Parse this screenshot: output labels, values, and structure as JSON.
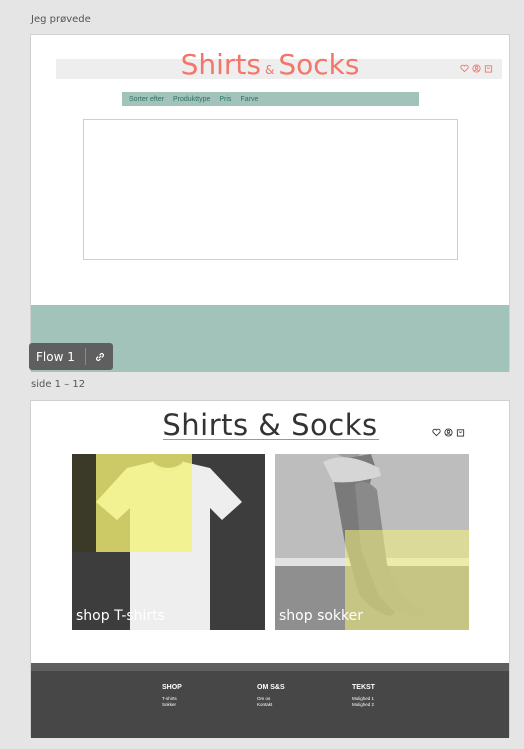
{
  "canvas": {
    "artboard1_label": "Jeg prøvede",
    "artboard2_label": "side 1 – 12"
  },
  "artboard1": {
    "title_part1": "Shirts",
    "title_amp": "&",
    "title_part2": "Socks",
    "filters": [
      "Sorter efter",
      "Produkttype",
      "Pris",
      "Farve"
    ],
    "accent_color": "#f2766a",
    "teal_color": "#a2c3b9"
  },
  "flow_badge": {
    "label": "Flow 1",
    "icon": "link-icon"
  },
  "artboard2": {
    "title": "Shirts & Socks",
    "icons": [
      "heart-icon",
      "user-icon",
      "bag-icon"
    ],
    "tiles": [
      {
        "label": "shop T-shirts",
        "image": "white t-shirt with yellow square overlay"
      },
      {
        "label": "shop sokker",
        "image": "legs in grey knit socks with yellow square overlay"
      }
    ],
    "footer": {
      "columns": [
        {
          "heading": "SHOP",
          "links": [
            "T-shirts",
            "Sokker"
          ]
        },
        {
          "heading": "OM S&S",
          "links": [
            "Om os",
            "Kontakt"
          ]
        },
        {
          "heading": "TEKST",
          "links": [
            "Mulighed 1",
            "Mulighed 2"
          ]
        }
      ]
    },
    "overlay_color": "#f5f37a",
    "footer_color": "#474747"
  }
}
